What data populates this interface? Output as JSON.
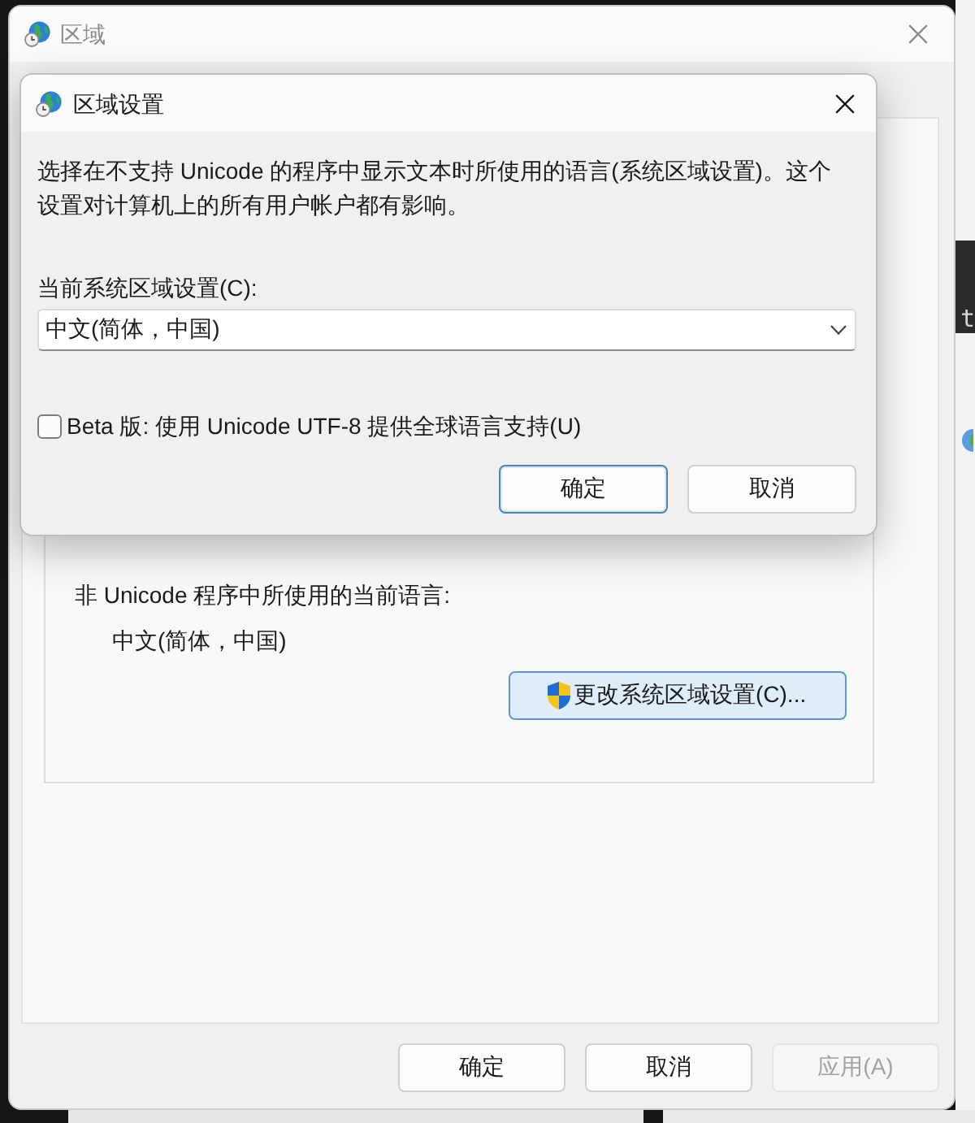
{
  "desktop": {
    "terminal_text": "t"
  },
  "window": {
    "title": "区域",
    "active": false,
    "language_group": {
      "label": "非 Unicode 程序中所使用的当前语言:",
      "value": "中文(简体，中国)",
      "change_button": "更改系统区域设置(C)..."
    },
    "buttons": [
      {
        "label": "确定",
        "disabled": false
      },
      {
        "label": "取消",
        "disabled": false
      },
      {
        "label": "应用(A)",
        "disabled": true
      }
    ]
  },
  "dialog": {
    "title": "区域设置",
    "active": true,
    "description": "选择在不支持 Unicode 的程序中显示文本时所使用的语言(系统区域设置)。这个设置对计算机上的所有用户帐户都有影响。",
    "locale_label": "当前系统区域设置(C):",
    "locale_select": {
      "value": "中文(简体，中国)"
    },
    "beta_option": {
      "label": "Beta 版: 使用 Unicode UTF-8 提供全球语言支持(U)",
      "checked": false
    },
    "buttons": [
      {
        "label": "确定",
        "default": true
      },
      {
        "label": "取消",
        "default": false
      }
    ]
  }
}
